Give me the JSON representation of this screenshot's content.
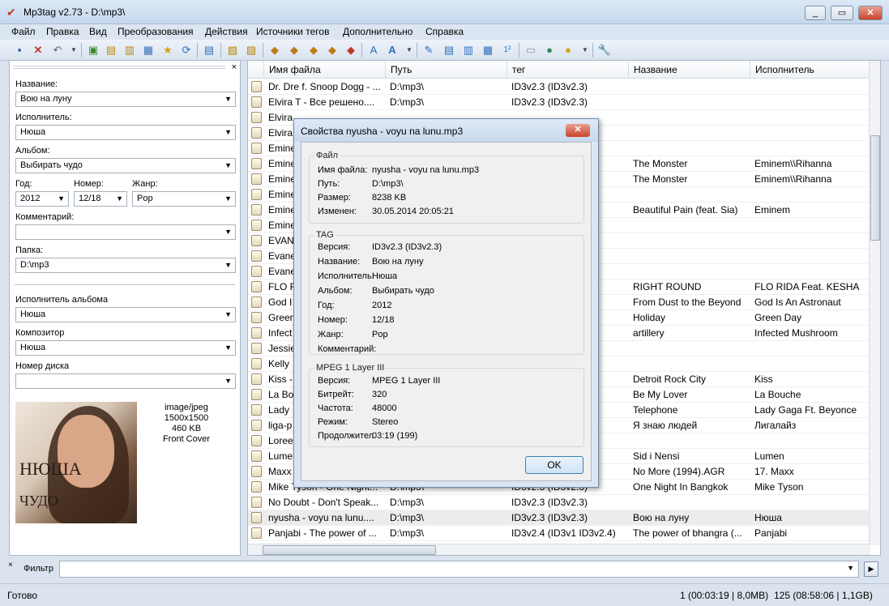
{
  "window": {
    "title": "Mp3tag v2.73  -  D:\\mp3\\",
    "min": "_",
    "max": "▭",
    "close": "✕"
  },
  "menu": [
    "Файл",
    "Правка",
    "Вид",
    "Преобразования",
    "Действия",
    "Источники тегов",
    "Дополнительно",
    "Справка"
  ],
  "toolbar": {
    "icons": [
      "save-icon",
      "delete-icon",
      "undo-icon",
      "add-folder-icon",
      "add-directory-icon",
      "open-folder-icon",
      "open-file-icon",
      "favorite-star-icon",
      "refresh-icon",
      "playlist-icon",
      "export-icon",
      "copy-tag-icon",
      "convert-icon",
      "tag-filename-icon",
      "filename-tag-icon",
      "text-tag-icon",
      "autonumber-icon",
      "case-conversion-icon",
      "edit-icon",
      "tag-sources-icon",
      "freedb-icon",
      "amazon-icon",
      "discogs-icon",
      "musicbrainz-icon",
      "web-icon",
      "world-icon",
      "tools-icon"
    ]
  },
  "panel": {
    "close": "×",
    "title_label": "Название:",
    "title_value": "Вою на луну",
    "artist_label": "Исполнитель:",
    "artist_value": "Нюша",
    "album_label": "Альбом:",
    "album_value": "Выбирать чудо",
    "year_label": "Год:",
    "year_value": "2012",
    "track_label": "Номер:",
    "track_value": "12/18",
    "genre_label": "Жанр:",
    "genre_value": "Pop",
    "comment_label": "Комментарий:",
    "comment_value": "",
    "folder_label": "Папка:",
    "folder_value": "D:\\mp3",
    "albumartist_label": "Исполнитель альбома",
    "albumartist_value": "Нюша",
    "composer_label": "Композитор",
    "composer_value": "Нюша",
    "disc_label": "Номер диска",
    "disc_value": "",
    "cover_info": [
      "image/jpeg",
      "1500x1500",
      "460 KB",
      "Front Cover"
    ],
    "cover_text1": "НЮША",
    "cover_text2": "ЧУДО"
  },
  "columns": [
    "Имя файла",
    "Путь",
    "тег",
    "Название",
    "Исполнитель"
  ],
  "rows": [
    {
      "file": "Dr. Dre f. Snoop Dogg - ...",
      "path": "D:\\mp3\\",
      "tag": "ID3v2.3 (ID3v2.3)",
      "title": "",
      "artist": ""
    },
    {
      "file": "Elvira T - Все решено....",
      "path": "D:\\mp3\\",
      "tag": "ID3v2.3 (ID3v2.3)",
      "title": "",
      "artist": ""
    },
    {
      "file": "Elvira",
      "path": "",
      "tag": "",
      "title": "",
      "artist": ""
    },
    {
      "file": "Elvira",
      "path": "",
      "tag": "",
      "title": "",
      "artist": ""
    },
    {
      "file": "Emine",
      "path": "",
      "tag": "",
      "title": "",
      "artist": ""
    },
    {
      "file": "Emine",
      "path": "",
      "tag": "3)",
      "title": "The Monster",
      "artist": "Eminem\\\\Rihanna"
    },
    {
      "file": "Emine",
      "path": "",
      "tag": "3)",
      "title": "The Monster",
      "artist": "Eminem\\\\Rihanna"
    },
    {
      "file": "Emine",
      "path": "",
      "tag": "",
      "title": "",
      "artist": ""
    },
    {
      "file": "Emine",
      "path": "",
      "tag": "3)",
      "title": "Beautiful Pain (feat. Sia)",
      "artist": "Eminem"
    },
    {
      "file": "Emine",
      "path": "",
      "tag": "",
      "title": "",
      "artist": ""
    },
    {
      "file": "EVAN",
      "path": "",
      "tag": "",
      "title": "",
      "artist": ""
    },
    {
      "file": "Evane",
      "path": "",
      "tag": "",
      "title": "",
      "artist": ""
    },
    {
      "file": "Evane",
      "path": "",
      "tag": "",
      "title": "",
      "artist": ""
    },
    {
      "file": "FLO R",
      "path": "",
      "tag": "3)",
      "title": "RIGHT ROUND",
      "artist": "FLO RIDA Feat. KESHA"
    },
    {
      "file": "God I",
      "path": "",
      "tag": "3)",
      "title": "From Dust to the Beyond",
      "artist": "God Is An Astronaut"
    },
    {
      "file": "Green",
      "path": "",
      "tag": "3)",
      "title": "Holiday",
      "artist": "Green Day"
    },
    {
      "file": "Infect",
      "path": "",
      "tag": "3)",
      "title": "artillery",
      "artist": "Infected Mushroom"
    },
    {
      "file": "Jessie",
      "path": "",
      "tag": "",
      "title": "",
      "artist": ""
    },
    {
      "file": "Kelly",
      "path": "",
      "tag": "",
      "title": "",
      "artist": ""
    },
    {
      "file": "Kiss -",
      "path": "",
      "tag": "3)",
      "title": "Detroit Rock City",
      "artist": "Kiss"
    },
    {
      "file": "La Bo",
      "path": "",
      "tag": "4)",
      "title": "Be My Lover",
      "artist": "La Bouche"
    },
    {
      "file": "Lady",
      "path": "",
      "tag": "3)",
      "title": "Telephone",
      "artist": "Lady Gaga Ft. Beyonce"
    },
    {
      "file": "liga-p",
      "path": "",
      "tag": "3)",
      "title": "Я знаю людей",
      "artist": "Лигалайз"
    },
    {
      "file": "Loree",
      "path": "",
      "tag": "",
      "title": "",
      "artist": ""
    },
    {
      "file": "Lume",
      "path": "",
      "tag": "3)",
      "title": "Sid i Nensi",
      "artist": "Lumen"
    },
    {
      "file": "Maxx",
      "path": "",
      "tag": "4)",
      "title": "No More (1994).AGR",
      "artist": "17. Maxx"
    },
    {
      "file": "Mike Tyson - One Night...",
      "path": "D:\\mp3\\",
      "tag": "ID3v2.3 (ID3v2.3)",
      "title": "One Night In Bangkok",
      "artist": "Mike Tyson"
    },
    {
      "file": "No Doubt - Don't Speak...",
      "path": "D:\\mp3\\",
      "tag": "ID3v2.3 (ID3v2.3)",
      "title": "",
      "artist": ""
    },
    {
      "file": "nyusha - voyu na lunu....",
      "path": "D:\\mp3\\",
      "tag": "ID3v2.3 (ID3v2.3)",
      "title": "Вою на луну",
      "artist": "Нюша"
    },
    {
      "file": "Panjabi - The power of ...",
      "path": "D:\\mp3\\",
      "tag": "ID3v2.4 (ID3v1 ID3v2.4)",
      "title": "The power of bhangra (...",
      "artist": "Panjabi"
    }
  ],
  "dialog": {
    "title": "Свойства nyusha - voyu na lunu.mp3",
    "close": "✕",
    "file_group": "Файл",
    "file": [
      {
        "k": "Имя файла:",
        "v": "nyusha - voyu na lunu.mp3"
      },
      {
        "k": "Путь:",
        "v": "D:\\mp3\\"
      },
      {
        "k": "Размер:",
        "v": "8238 KB"
      },
      {
        "k": "Изменен:",
        "v": "30.05.2014 20:05:21"
      }
    ],
    "tag_group": "TAG",
    "tag": [
      {
        "k": "Версия:",
        "v": "ID3v2.3 (ID3v2.3)"
      },
      {
        "k": "Название:",
        "v": "Вою на луну"
      },
      {
        "k": "Исполнитель:",
        "v": "Нюша"
      },
      {
        "k": "Альбом:",
        "v": "Выбирать чудо"
      },
      {
        "k": "Год:",
        "v": "2012"
      },
      {
        "k": "Номер:",
        "v": "12/18"
      },
      {
        "k": "Жанр:",
        "v": "Pop"
      },
      {
        "k": "Комментарий:",
        "v": ""
      }
    ],
    "mpeg_group": "MPEG 1 Layer III",
    "mpeg": [
      {
        "k": "Версия:",
        "v": "MPEG 1 Layer III"
      },
      {
        "k": "Битрейт:",
        "v": "320"
      },
      {
        "k": "Частота:",
        "v": "48000"
      },
      {
        "k": "Режим:",
        "v": "Stereo"
      },
      {
        "k": "Продолжител",
        "v": "03:19 (199)"
      }
    ],
    "ok": "OK"
  },
  "filter": {
    "close": "×",
    "label": "Фильтр",
    "value": "",
    "go": "▶"
  },
  "status": {
    "left": "Готово",
    "selected": "1 (00:03:19 | 8,0MB)",
    "total": "125 (08:58:06 | 1,1GB)"
  }
}
